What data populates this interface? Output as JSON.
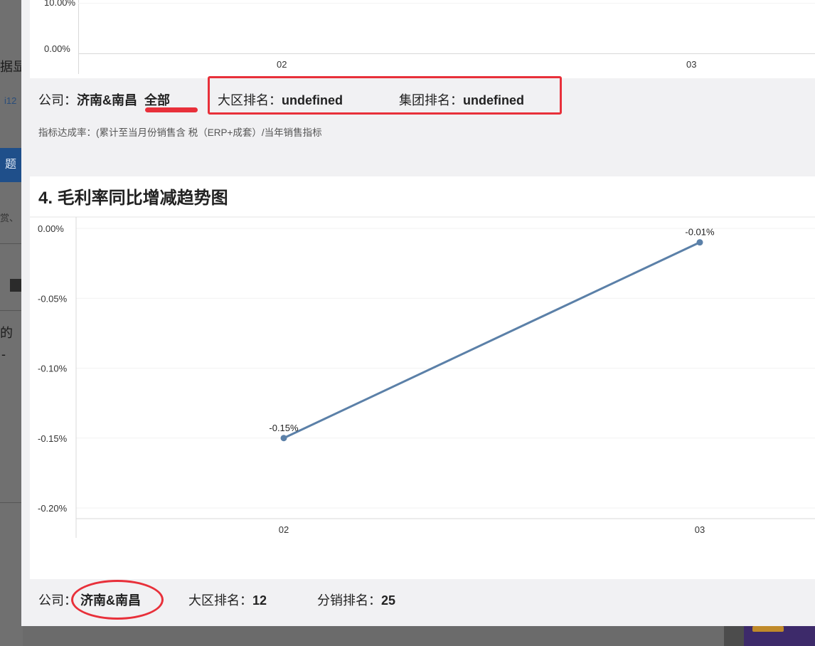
{
  "background": {
    "frag1": "据显",
    "frag2": "i12",
    "frag3": "题",
    "frag4": "赏、",
    "frag5": "的",
    "frag6": "-"
  },
  "top_chart": {
    "y_ticks": [
      "10.00%",
      "0.00%"
    ],
    "x_ticks": [
      "02",
      "03"
    ]
  },
  "top_info": {
    "company_label": "公司：",
    "company_value": "济南&南昌",
    "scope_value": "全部",
    "region_rank_label": "大区排名：",
    "region_rank_value": "undefined",
    "group_rank_label": "集团排名：",
    "group_rank_value": "undefined"
  },
  "note": "指标达成率：(累计至当月份销售含 税（ERP+成套）/当年销售指标",
  "section_title": "4. 毛利率同比增减趋势图",
  "chart_data": {
    "type": "line",
    "x": [
      "02",
      "03"
    ],
    "series": [
      {
        "values": [
          -0.15,
          -0.01
        ],
        "labels": [
          "-0.15%",
          "-0.01%"
        ]
      }
    ],
    "y_ticks": [
      "0.00%",
      "-0.05%",
      "-0.10%",
      "-0.15%",
      "-0.20%"
    ],
    "ylim": [
      -0.2,
      0
    ],
    "line_color": "#5b80a8"
  },
  "bottom_info": {
    "company_label": "公司：",
    "company_value": "济南&南昌",
    "region_rank_label": "大区排名：",
    "region_rank_value": "12",
    "dist_rank_label": "分销排名：",
    "dist_rank_value": "25"
  },
  "colors": {
    "annotation_red": "#e8303a",
    "panel_bg": "#f1f1f3"
  }
}
